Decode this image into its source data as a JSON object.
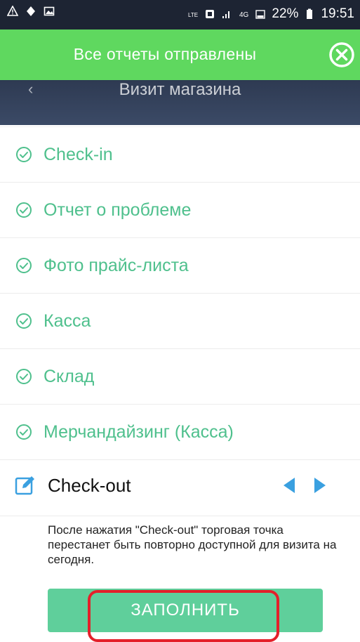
{
  "status_bar": {
    "battery": "22%",
    "time": "19:51",
    "icons": [
      "warning-icon",
      "location-icon",
      "image-icon",
      "volte-icon",
      "nfc-icon",
      "signal-icon",
      "data-icon",
      "battery-icon"
    ]
  },
  "toast": {
    "message": "Все отчеты отправлены",
    "close_icon": "close-circle-icon",
    "color": "#5fd85f"
  },
  "header": {
    "title": "Визит магазина",
    "background": "#2e3a52"
  },
  "tasks": [
    {
      "label": "Check-in",
      "status": "done"
    },
    {
      "label": "Отчет о проблеме",
      "status": "done"
    },
    {
      "label": "Фото прайс-листа",
      "status": "done"
    },
    {
      "label": "Касса",
      "status": "done"
    },
    {
      "label": "Склад",
      "status": "done"
    },
    {
      "label": "Мерчандайзинг (Касса)",
      "status": "done"
    }
  ],
  "checkout": {
    "label": "Check-out",
    "icon": "edit-icon",
    "note": "После нажатия \"Check-out\" торговая точка перестанет быть повторно доступной для визита на сегодня.",
    "button_label": "ЗАПОЛНИТЬ"
  },
  "colors": {
    "accent_green": "#4fc08d",
    "button_green": "#5fcf9b",
    "nav_arrow": "#3aa0e0",
    "highlight_red": "#e4202a"
  }
}
